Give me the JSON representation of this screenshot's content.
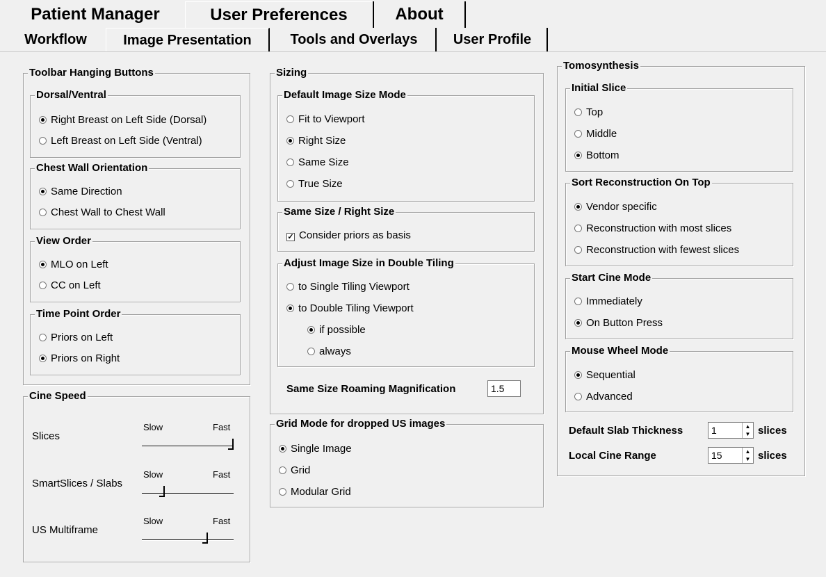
{
  "top_tabs": [
    {
      "label": "Patient Manager"
    },
    {
      "label": "User Preferences"
    },
    {
      "label": "About"
    }
  ],
  "sub_tabs": [
    {
      "label": "Workflow"
    },
    {
      "label": "Image Presentation"
    },
    {
      "label": "Tools and Overlays"
    },
    {
      "label": "User Profile"
    }
  ],
  "toolbar_hanging": {
    "title": "Toolbar Hanging Buttons",
    "dorsal_ventral": {
      "title": "Dorsal/Ventral",
      "options": [
        {
          "label": "Right Breast on Left Side (Dorsal)",
          "selected": true
        },
        {
          "label": "Left Breast on Left Side (Ventral)",
          "selected": false
        }
      ]
    },
    "chest_wall": {
      "title": "Chest Wall Orientation",
      "options": [
        {
          "label": "Same Direction",
          "selected": true
        },
        {
          "label": "Chest Wall to Chest Wall",
          "selected": false
        }
      ]
    },
    "view_order": {
      "title": "View Order",
      "options": [
        {
          "label": "MLO on Left",
          "selected": true
        },
        {
          "label": "CC on Left",
          "selected": false
        }
      ]
    },
    "time_point": {
      "title": "Time Point Order",
      "options": [
        {
          "label": "Priors on Left",
          "selected": false
        },
        {
          "label": "Priors on Right",
          "selected": true
        }
      ]
    }
  },
  "cine_speed": {
    "title": "Cine Speed",
    "slow": "Slow",
    "fast": "Fast",
    "sliders": [
      {
        "label": "Slices",
        "value": 1.0
      },
      {
        "label": "SmartSlices / Slabs",
        "value": 0.2
      },
      {
        "label": "US Multiframe",
        "value": 0.7
      }
    ]
  },
  "sizing": {
    "title": "Sizing",
    "default_mode": {
      "title": "Default Image Size Mode",
      "options": [
        {
          "label": "Fit to Viewport",
          "selected": false
        },
        {
          "label": "Right Size",
          "selected": true
        },
        {
          "label": "Same Size",
          "selected": false
        },
        {
          "label": "True Size",
          "selected": false
        }
      ]
    },
    "same_right": {
      "title": "Same Size / Right Size",
      "checkbox": {
        "label": "Consider priors as basis",
        "checked": true
      }
    },
    "double_tiling": {
      "title": "Adjust Image Size in Double Tiling",
      "options": [
        {
          "label": "to Single Tiling Viewport",
          "selected": false
        },
        {
          "label": "to Double Tiling Viewport",
          "selected": true
        }
      ],
      "sub_options": [
        {
          "label": "if possible",
          "selected": true
        },
        {
          "label": "always",
          "selected": false
        }
      ]
    },
    "roaming_label": "Same Size Roaming Magnification",
    "roaming_value": "1.5"
  },
  "grid_mode": {
    "title": "Grid Mode for dropped US images",
    "options": [
      {
        "label": "Single Image",
        "selected": true
      },
      {
        "label": "Grid",
        "selected": false
      },
      {
        "label": "Modular Grid",
        "selected": false
      }
    ]
  },
  "tomo": {
    "title": "Tomosynthesis",
    "initial_slice": {
      "title": "Initial Slice",
      "options": [
        {
          "label": "Top",
          "selected": false
        },
        {
          "label": "Middle",
          "selected": false
        },
        {
          "label": "Bottom",
          "selected": true
        }
      ]
    },
    "sort_recon": {
      "title": "Sort Reconstruction On Top",
      "options": [
        {
          "label": "Vendor specific",
          "selected": true
        },
        {
          "label": "Reconstruction with most slices",
          "selected": false
        },
        {
          "label": "Reconstruction with fewest slices",
          "selected": false
        }
      ]
    },
    "start_cine": {
      "title": "Start Cine Mode",
      "options": [
        {
          "label": "Immediately",
          "selected": false
        },
        {
          "label": "On Button Press",
          "selected": true
        }
      ]
    },
    "mouse_wheel": {
      "title": "Mouse Wheel Mode",
      "options": [
        {
          "label": "Sequential",
          "selected": true
        },
        {
          "label": "Advanced",
          "selected": false
        }
      ]
    },
    "slab_label": "Default Slab Thickness",
    "slab_value": "1",
    "slab_unit": "slices",
    "cine_range_label": "Local Cine Range",
    "cine_range_value": "15",
    "cine_range_unit": "slices"
  }
}
